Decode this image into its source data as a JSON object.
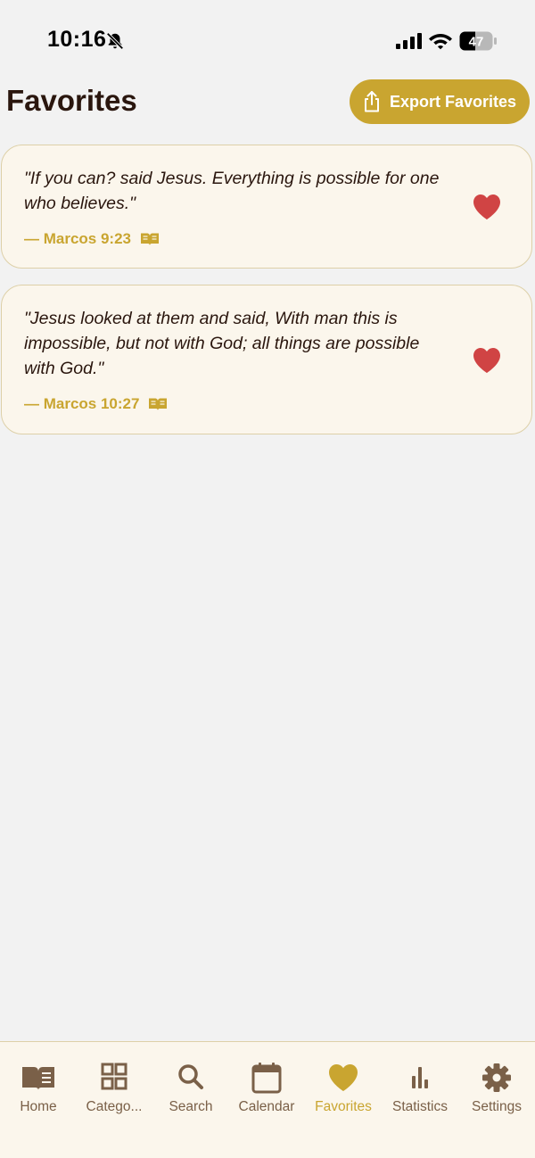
{
  "status_bar": {
    "time": "10:16",
    "battery_level": "47"
  },
  "header": {
    "title": "Favorites",
    "export_button_label": "Export Favorites"
  },
  "favorites": [
    {
      "text": "\"If you can? said Jesus. Everything is possible for one who believes.\"",
      "reference": "— Marcos 9:23"
    },
    {
      "text": "\"Jesus looked at them and said, With man this is impossible, but not with God; all things are possible with God.\"",
      "reference": "— Marcos 10:27"
    }
  ],
  "tab_bar": {
    "items": [
      {
        "label": "Home",
        "icon": "book-icon"
      },
      {
        "label": "Catego...",
        "icon": "grid-icon"
      },
      {
        "label": "Search",
        "icon": "search-icon"
      },
      {
        "label": "Calendar",
        "icon": "calendar-icon"
      },
      {
        "label": "Favorites",
        "icon": "heart-icon"
      },
      {
        "label": "Statistics",
        "icon": "bar-chart-icon"
      },
      {
        "label": "Settings",
        "icon": "gear-icon"
      }
    ],
    "active": "Favorites"
  },
  "colors": {
    "accent": "#c9a530",
    "heart": "#d04444",
    "card_bg": "#fbf6ec",
    "title": "#2a160e",
    "tab_inactive": "#7a6048"
  }
}
